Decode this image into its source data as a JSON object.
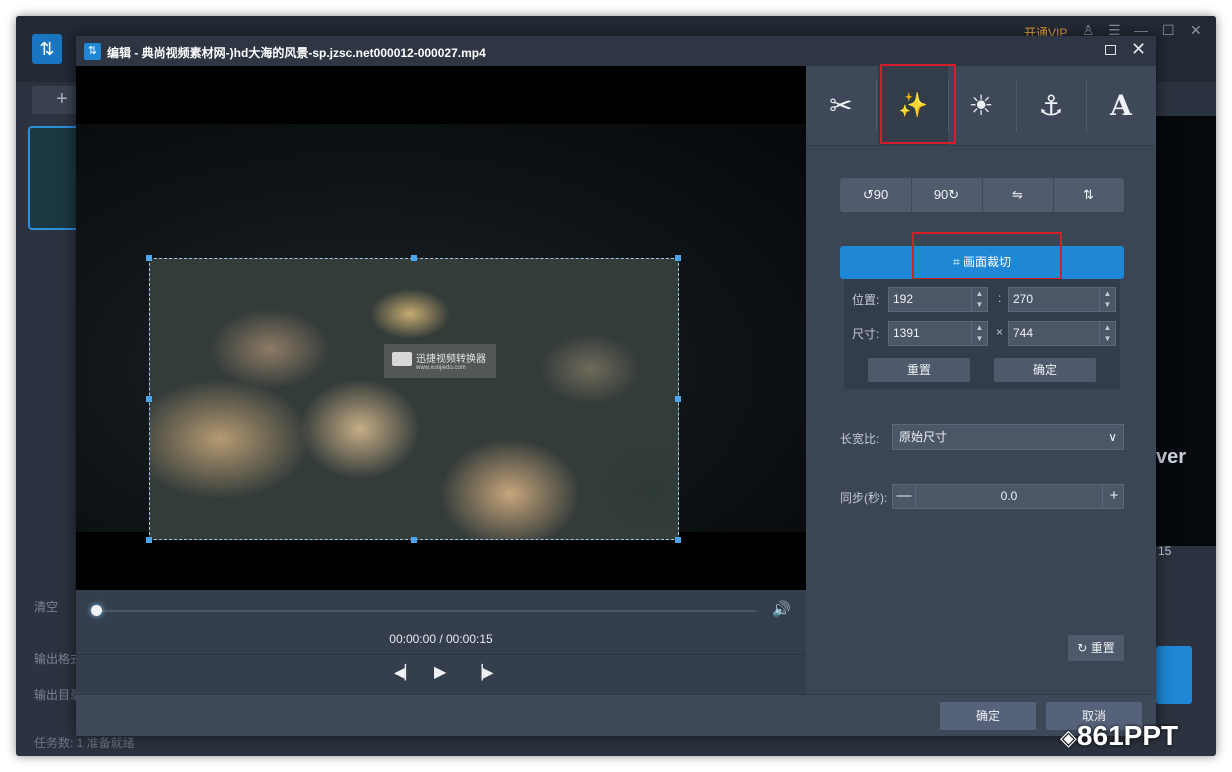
{
  "outer_app": {
    "vip_label": "开通VIP",
    "controls": [
      "♙",
      "☰",
      "—",
      "☐",
      "✕"
    ],
    "add_label": "+",
    "left_labels": [
      "清空",
      "输出格式",
      "输出目录"
    ],
    "status_text": "任务数: 1   准备就绪",
    "preview_text": "ver",
    "preview_time": "15"
  },
  "dialog": {
    "title": "编辑 - 典尚视频素材网-)hd大海的风景-sp.jzsc.net000012-000027.mp4"
  },
  "player": {
    "watermark_text": "迅捷视频转换器",
    "watermark_subtext": "www.xunjiedo.com",
    "time_text": "00:00:00 / 00:00:15",
    "progress": 0.0
  },
  "tools": {
    "items": [
      {
        "name": "cut",
        "icon": "scissors-icon",
        "glyph": "✂"
      },
      {
        "name": "effects",
        "icon": "magic-wand-icon",
        "glyph": "✨",
        "active": true
      },
      {
        "name": "adjust",
        "icon": "brightness-icon",
        "glyph": "☀"
      },
      {
        "name": "watermark",
        "icon": "stamp-icon",
        "glyph": "⚓"
      },
      {
        "name": "text",
        "icon": "text-icon",
        "glyph": "A"
      }
    ]
  },
  "rotate": {
    "left_label": "90",
    "right_label": "90",
    "flip_h_label": "⇋",
    "flip_v_label": "⇅"
  },
  "crop": {
    "button_label": "画面裁切",
    "position_label": "位置:",
    "size_label": "尺寸:",
    "pos_x": "192",
    "pos_y": "270",
    "width": "1391",
    "height": "744",
    "pos_sep": ":",
    "size_sep": "×",
    "reset_label": "重置",
    "confirm_label": "确定"
  },
  "aspect": {
    "label": "长宽比:",
    "value": "原始尺寸"
  },
  "sync": {
    "label": "同步(秒):",
    "value": "0.0",
    "minus": "—",
    "plus": "+"
  },
  "panel_reset_label": "重置",
  "footer": {
    "confirm_label": "确定",
    "cancel_label": "取消"
  },
  "brand": {
    "text": "861PPT"
  }
}
